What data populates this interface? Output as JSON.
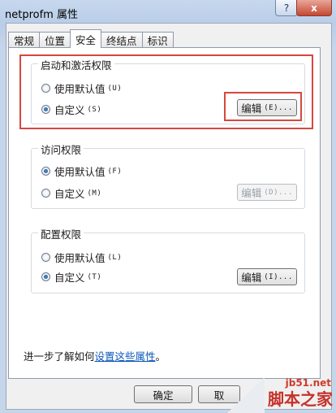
{
  "window": {
    "title": "netprofm 属性",
    "help_label": "?",
    "close_label": "x"
  },
  "tabs": [
    "常规",
    "位置",
    "安全",
    "终结点",
    "标识"
  ],
  "groups": {
    "launch": {
      "title": "启动和激活权限",
      "options": [
        {
          "label": "使用默认值",
          "key": "(U)",
          "checked": false
        },
        {
          "label": "自定义",
          "key": "(S)",
          "checked": true
        }
      ],
      "edit_label": "编辑",
      "edit_key": "(E)...",
      "edit_enabled": true
    },
    "access": {
      "title": "访问权限",
      "options": [
        {
          "label": "使用默认值",
          "key": "(F)",
          "checked": true
        },
        {
          "label": "自定义",
          "key": "(M)",
          "checked": false
        }
      ],
      "edit_label": "编辑",
      "edit_key": "(D)...",
      "edit_enabled": false
    },
    "config": {
      "title": "配置权限",
      "options": [
        {
          "label": "使用默认值",
          "key": "(L)",
          "checked": false
        },
        {
          "label": "自定义",
          "key": "(T)",
          "checked": true
        }
      ],
      "edit_label": "编辑",
      "edit_key": "(I)...",
      "edit_enabled": true
    }
  },
  "footer": {
    "prefix": "进一步了解如何",
    "link": "设置这些属性",
    "suffix": "。"
  },
  "buttons": {
    "ok": "确定",
    "cancel_partial": "取"
  },
  "watermark": {
    "site": "jb51.net",
    "name": "脚本之家"
  }
}
